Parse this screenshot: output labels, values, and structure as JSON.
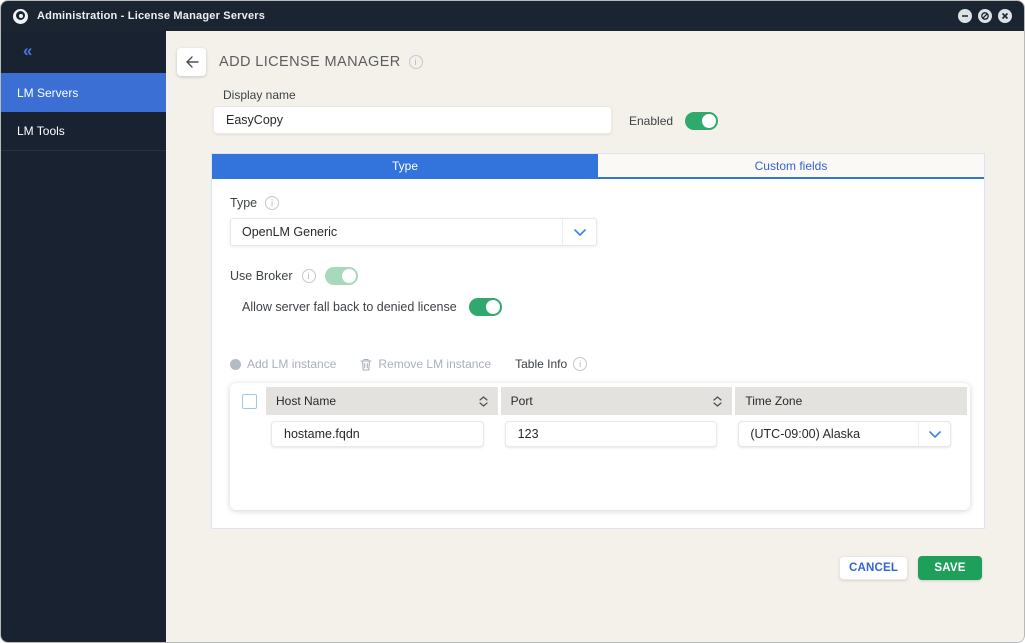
{
  "window": {
    "title": "Administration - License Manager Servers"
  },
  "sidebar": {
    "collapse_label": "«",
    "items": [
      {
        "label": "LM Servers",
        "active": true
      },
      {
        "label": "LM Tools",
        "active": false
      }
    ]
  },
  "page": {
    "title": "ADD LICENSE MANAGER"
  },
  "form": {
    "display_name_label": "Display name",
    "display_name_value": "EasyCopy",
    "enabled_label": "Enabled",
    "tabs": [
      {
        "label": "Type",
        "active": true
      },
      {
        "label": "Custom fields",
        "active": false
      }
    ],
    "type_label": "Type",
    "type_value": "OpenLM Generic",
    "use_broker_label": "Use Broker",
    "fallback_label": "Allow server fall back to denied license",
    "toggles": {
      "enabled": "on",
      "use_broker": "on",
      "fallback": "on"
    },
    "toolbar": {
      "add_label": "Add LM instance",
      "remove_label": "Remove LM instance",
      "table_info_label": "Table Info"
    },
    "table": {
      "columns": [
        {
          "label": "Host Name",
          "sortable": true
        },
        {
          "label": "Port",
          "sortable": true
        },
        {
          "label": "Time Zone",
          "sortable": false
        }
      ],
      "rows": [
        {
          "host_name": "hostame.fqdn",
          "port": "123",
          "time_zone": "(UTC-09:00) Alaska"
        }
      ]
    },
    "actions": {
      "cancel_label": "CANCEL",
      "save_label": "SAVE"
    }
  },
  "colors": {
    "titlebar": "#1b2531",
    "sidebar": "#182230",
    "accent_blue": "#3273dc",
    "selected_blue": "#3b6fd4",
    "toggle_green": "#2fa96c",
    "use_broker_green": "#a9d9bd",
    "save_green": "#1fa05a",
    "background": "#f4f1ea",
    "table_header": "#e4e2df"
  }
}
